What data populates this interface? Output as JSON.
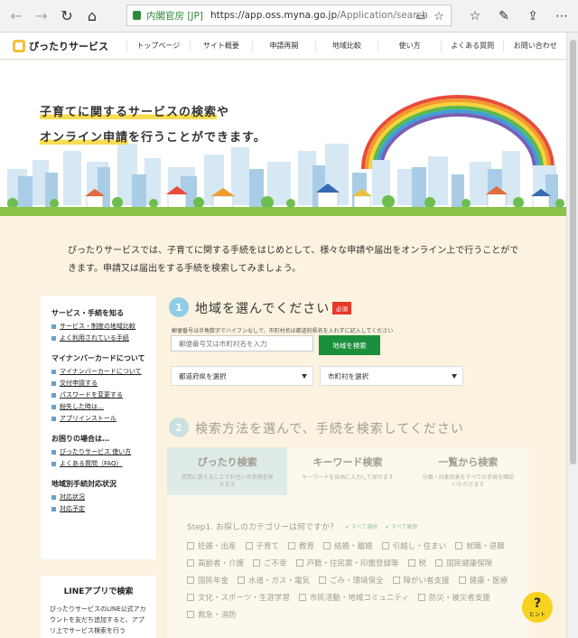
{
  "browser": {
    "owner": "内閣官房 [JP]",
    "url_host": "https://app.oss.myna.go.jp",
    "url_path": "/Application/search"
  },
  "site": {
    "logo": "ぴったりサービス",
    "nav": [
      "トップページ",
      "サイト概要",
      "申請再開",
      "地域比較",
      "使い方",
      "よくある質問",
      "お問い合わせ"
    ]
  },
  "hero": {
    "line1_hl": "子育てに関するサービスの検索",
    "line1_rest": "や",
    "line2_hl": "オンライン申請",
    "line2_rest": "を行うことができます。"
  },
  "intro": "ぴったりサービスでは、子育てに関する手続をはじめとして、様々な申請や届出をオンライン上で行うことができます。申請又は届出をする手続を検索してみましょう。",
  "sidebar": {
    "sections": [
      {
        "title": "サービス・手続を知る",
        "links": [
          "サービス・制度の地域比較",
          "よく利用されている手続"
        ]
      },
      {
        "title": "マイナンバーカードについて",
        "links": [
          "マイナンバーカードについて",
          "交付申請する",
          "パスワードを変更する",
          "紛失した時は…",
          "アプリインストール"
        ]
      },
      {
        "title": "お困りの場合は…",
        "links": [
          "ぴったりサービス 使い方",
          "よくある質問（FAQ）"
        ]
      },
      {
        "title": "地域別手続対応状況",
        "links": [
          "対応状況",
          "対応予定"
        ]
      }
    ]
  },
  "line_box": {
    "title": "LINEアプリで検索",
    "desc": "ぴったりサービスのLINE公式アカウントを友だち追加すると、アプリ上でサービス検索を行う"
  },
  "step1": {
    "num": "1",
    "title": "地域を選んでください",
    "required": "必須",
    "hint": "郵便番号は半角数字でハイフンなしで、市町村名は都道府県名を入れずに記入してください",
    "input_placeholder": "郵便番号又は市町村名を入力",
    "search_button": "地域を検索",
    "prefecture_select": "都道府県を選択",
    "city_select": "市町村を選択"
  },
  "step2": {
    "num": "2",
    "title": "検索方法を選んで、手続を検索してください",
    "tabs": [
      {
        "label": "ぴったり検索",
        "desc": "質問に答えることでお住いの手続を探せます"
      },
      {
        "label": "キーワード検索",
        "desc": "キーワードを自由に入力して探せます"
      },
      {
        "label": "一覧から検索",
        "desc": "分類・対象別表をすべての手続を確認いただけます"
      }
    ],
    "category_question": "Step1. お探しのカテゴリーは何ですか？",
    "select_all": "すべて選択",
    "clear_all": "すべて解除",
    "categories": [
      "妊娠・出産",
      "子育て",
      "教育",
      "結婚・離婚",
      "引越し・住まい",
      "就職・退職",
      "高齢者・介護",
      "ご不幸",
      "戸籍・住民票・印鑑登録等",
      "税",
      "国民健康保険",
      "国民年金",
      "水道・ガス・電気",
      "ごみ・環境保全",
      "障がい者支援",
      "健康・医療",
      "文化・スポーツ・生涯学習",
      "市民活動・地域コミュニティ",
      "防災・被災者支援",
      "救急・消防"
    ]
  },
  "hint_button": {
    "mark": "?",
    "label": "ヒント"
  },
  "colors": {
    "brand_yellow": "#f8dd52",
    "green": "#1a8f3c",
    "step_blue": "#8fcde6",
    "required_red": "#e83828"
  },
  "icons": [
    "back-icon",
    "forward-icon",
    "reload-icon",
    "home-icon",
    "lock-icon",
    "reading-view-icon",
    "favorite-star-icon",
    "favorites-list-icon",
    "pen-icon",
    "share-icon",
    "more-icon"
  ]
}
